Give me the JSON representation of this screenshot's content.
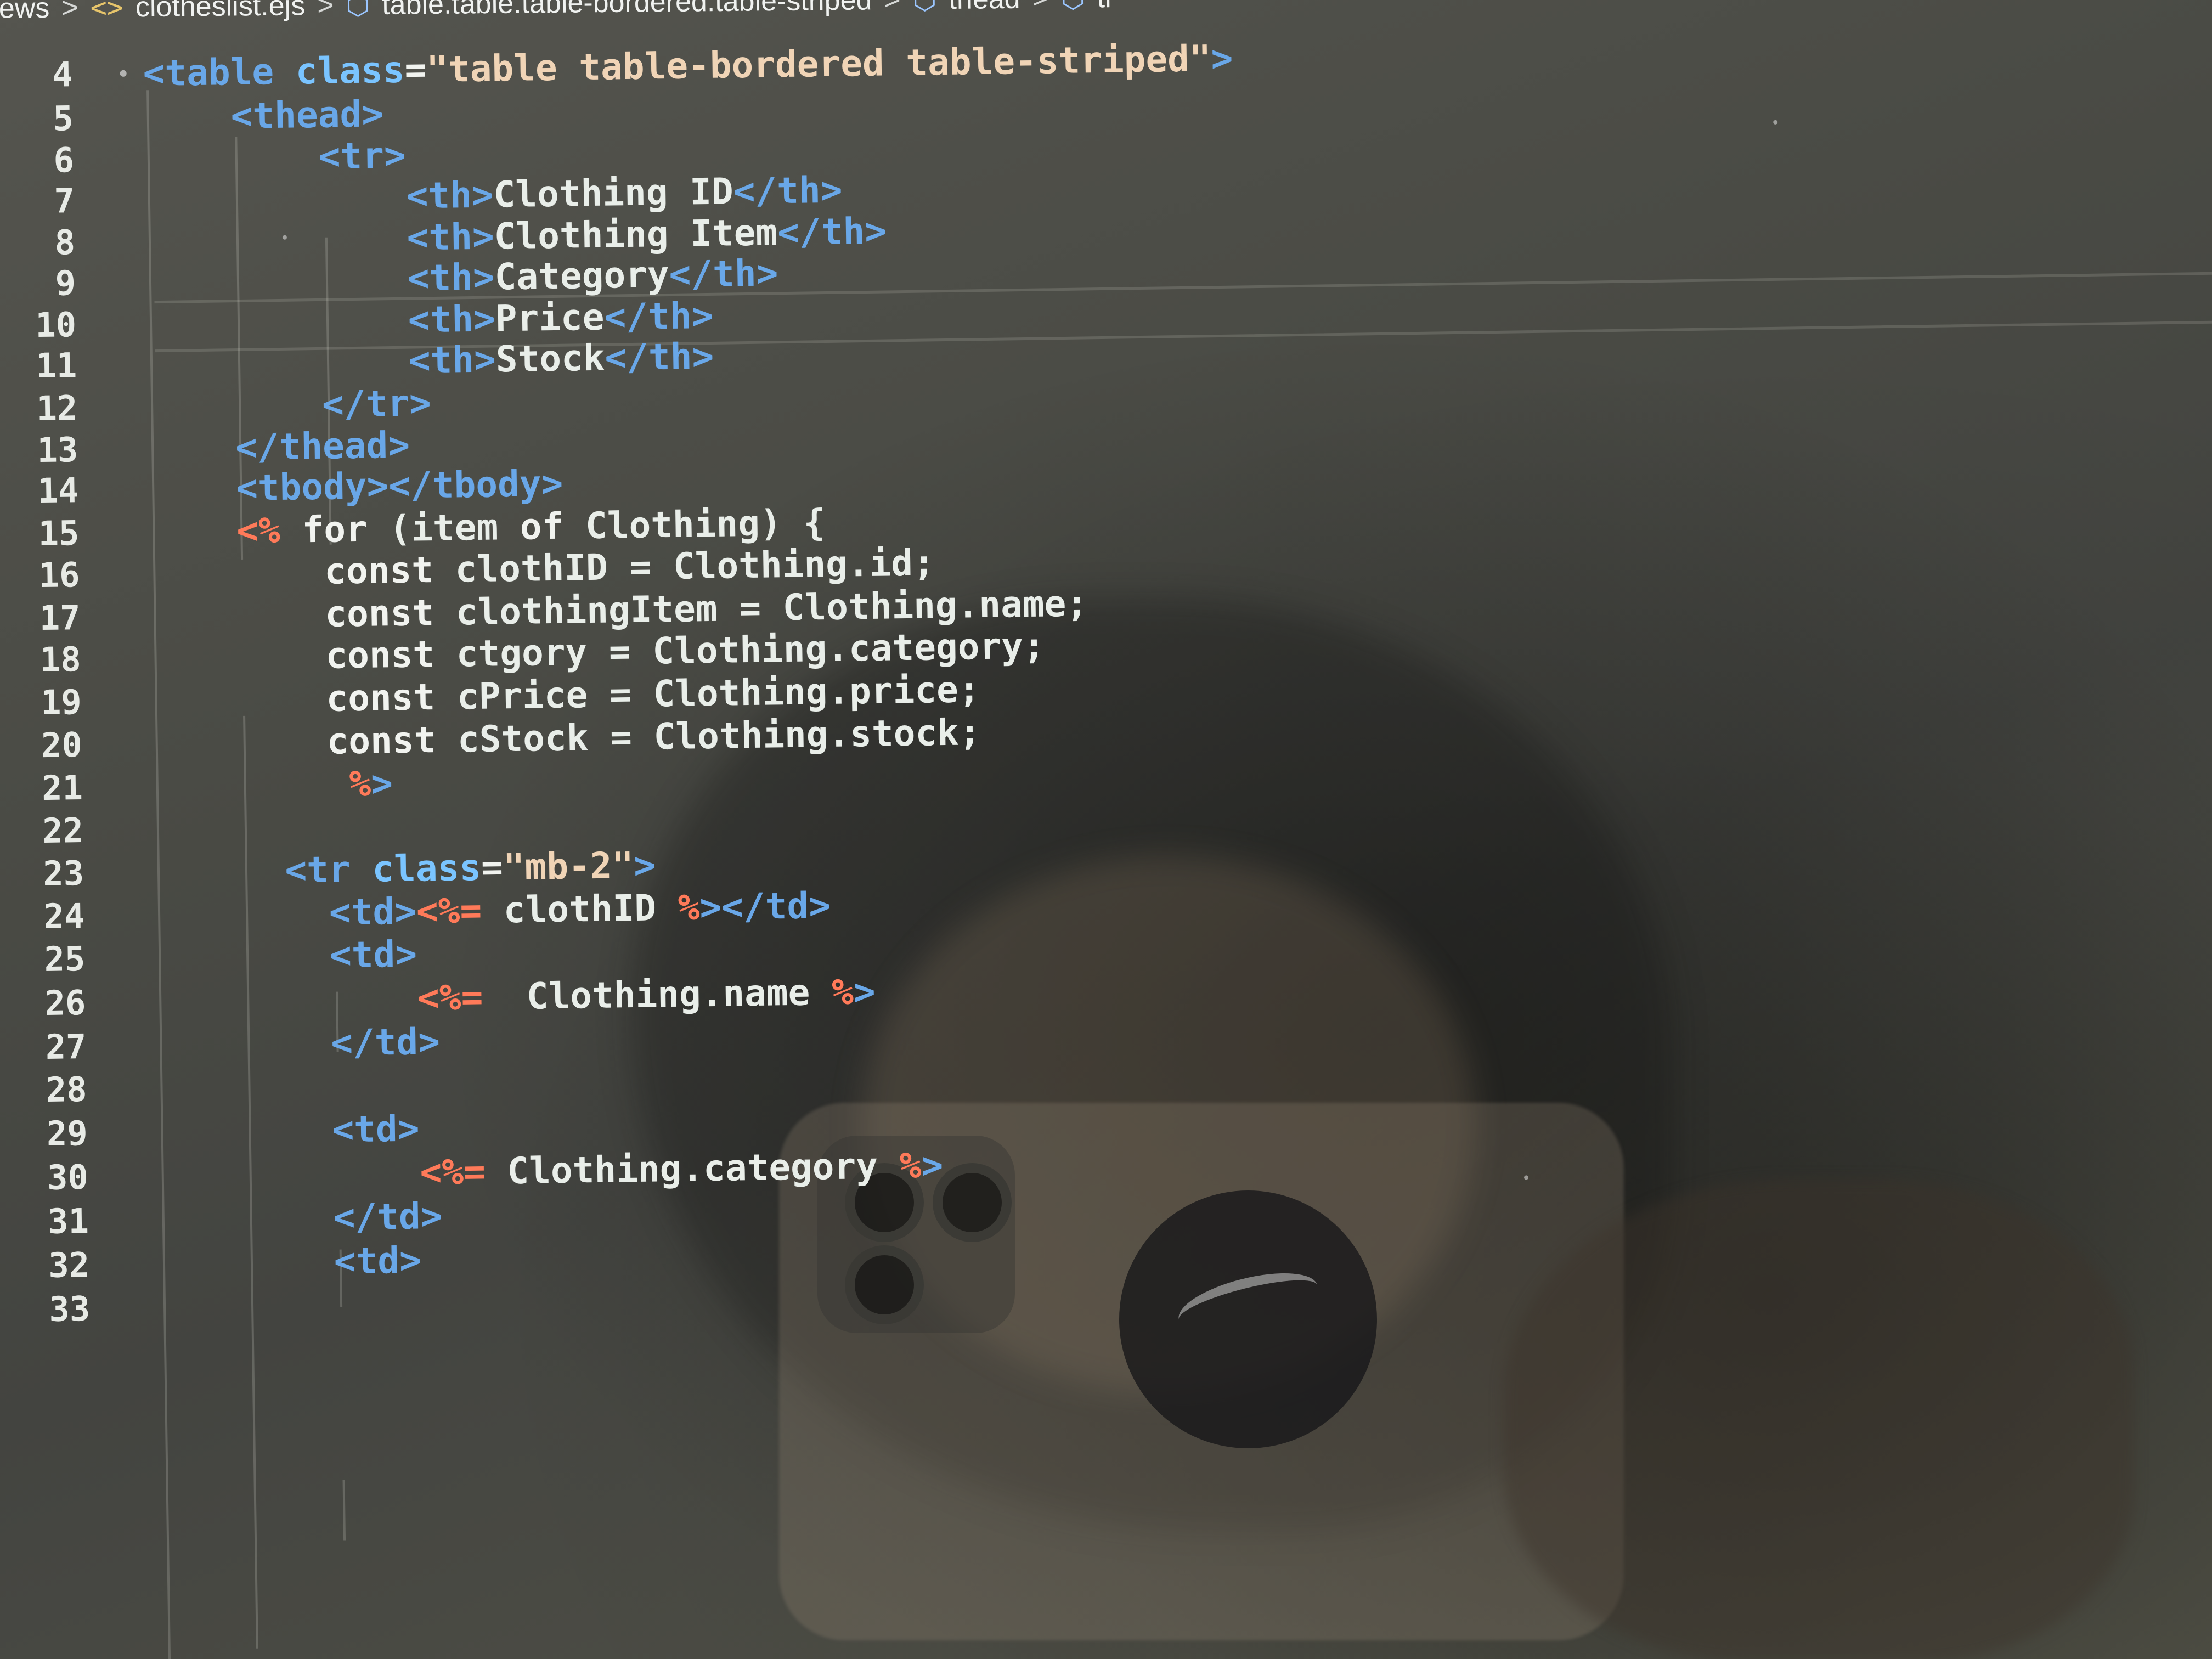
{
  "breadcrumb": {
    "items": [
      {
        "label": "views",
        "icon": ""
      },
      {
        "label": "clotheslist.ejs",
        "icon": "<>"
      },
      {
        "label": "table.table.table-bordered.table-striped",
        "icon": "cube"
      },
      {
        "label": "thead",
        "icon": "cube"
      },
      {
        "label": "tr",
        "icon": "cube"
      }
    ]
  },
  "editor": {
    "current_line": 10,
    "lines": [
      {
        "number": "4",
        "code": "<table class=\"table table-bordered table-striped\">"
      },
      {
        "number": "5",
        "code": "    <thead>"
      },
      {
        "number": "6",
        "code": "        <tr>"
      },
      {
        "number": "7",
        "code": "            <th>Clothing ID</th>"
      },
      {
        "number": "8",
        "code": "            <th>Clothing Item</th>"
      },
      {
        "number": "9",
        "code": "            <th>Category</th>"
      },
      {
        "number": "10",
        "code": "            <th>Price</th>"
      },
      {
        "number": "11",
        "code": "            <th>Stock</th>"
      },
      {
        "number": "12",
        "code": "        </tr>"
      },
      {
        "number": "13",
        "code": "    </thead>"
      },
      {
        "number": "14",
        "code": "    <tbody></tbody>"
      },
      {
        "number": "15",
        "code": "    <% for (item of Clothing) {"
      },
      {
        "number": "16",
        "code": "        const clothID = Clothing.id;"
      },
      {
        "number": "17",
        "code": "        const clothingItem = Clothing.name;"
      },
      {
        "number": "18",
        "code": "        const ctgory = Clothing.category;"
      },
      {
        "number": "19",
        "code": "        const cPrice = Clothing.price;"
      },
      {
        "number": "20",
        "code": "        const cStock = Clothing.stock;"
      },
      {
        "number": "21",
        "code": "         %>"
      },
      {
        "number": "22",
        "code": ""
      },
      {
        "number": "23",
        "code": "      <tr class=\"mb-2\">"
      },
      {
        "number": "24",
        "code": "        <td><%= clothID %></td>"
      },
      {
        "number": "25",
        "code": "        <td>"
      },
      {
        "number": "26",
        "code": "            <%=  Clothing.name %>"
      },
      {
        "number": "27",
        "code": "        </td>"
      },
      {
        "number": "28",
        "code": ""
      },
      {
        "number": "29",
        "code": "        <td>"
      },
      {
        "number": "30",
        "code": "            <%= Clothing.category %>"
      },
      {
        "number": "31",
        "code": "        </td>"
      },
      {
        "number": "32",
        "code": "        <td>"
      },
      {
        "number": "33",
        "code": ""
      }
    ]
  },
  "colors": {
    "tag": "#69a7e8",
    "attribute": "#7ac4ff",
    "string": "#f0d4b6",
    "text": "#f1f3ef",
    "ejs_delimiter": "#ff7a59"
  }
}
